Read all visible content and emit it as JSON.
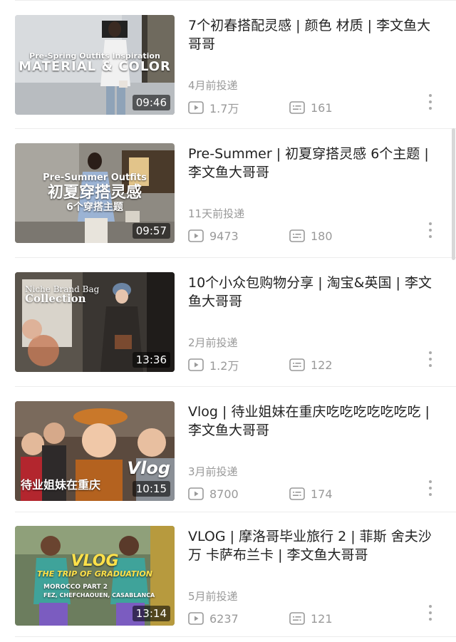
{
  "videos": [
    {
      "title": "7个初春搭配灵感 | 颜色 材质 | 李文鱼大哥哥",
      "posted": "4月前投递",
      "plays": "1.7万",
      "comments": "161",
      "duration": "09:46",
      "thumb_line1": "Pre-Spring Outfits Inspiration",
      "thumb_line2": "MATERIAL & COLOR"
    },
    {
      "title": "Pre-Summer | 初夏穿搭灵感 6个主题 | 李文鱼大哥哥",
      "posted": "11天前投递",
      "plays": "9473",
      "comments": "180",
      "duration": "09:57",
      "thumb_line1": "Pre-Summer Outfits",
      "thumb_line2": "初夏穿搭灵感",
      "thumb_line3": "6个穿搭主题"
    },
    {
      "title": "10个小众包购物分享 | 淘宝&英国 | 李文鱼大哥哥",
      "posted": "2月前投递",
      "plays": "1.2万",
      "comments": "122",
      "duration": "13:36",
      "thumb_line1": "Niche Brand Bag",
      "thumb_line2": "Collection"
    },
    {
      "title": "Vlog | 待业姐妹在重庆吃吃吃吃吃吃吃 | 李文鱼大哥哥",
      "posted": "3月前投递",
      "plays": "8700",
      "comments": "174",
      "duration": "10:15",
      "thumb_line1": "Vlog",
      "thumb_line2": "待业姐妹在重庆"
    },
    {
      "title": "VLOG | 摩洛哥毕业旅行 2 | 菲斯 舍夫沙万 卡萨布兰卡 | 李文鱼大哥哥",
      "posted": "5月前投递",
      "plays": "6237",
      "comments": "121",
      "duration": "13:14",
      "thumb_line1": "VLOG",
      "thumb_line2": "THE TRIP OF GRADUATION",
      "thumb_line3": "MOROCCO PART 2",
      "thumb_line4": "FEZ, CHEFCHAOUEN, CASABLANCA"
    }
  ],
  "icons": {
    "play": "play-count-icon",
    "comment": "danmaku-count-icon",
    "more": "more-options-icon"
  },
  "colors": {
    "meta_text": "#999999",
    "title_text": "#222222",
    "divider": "#ececec"
  }
}
